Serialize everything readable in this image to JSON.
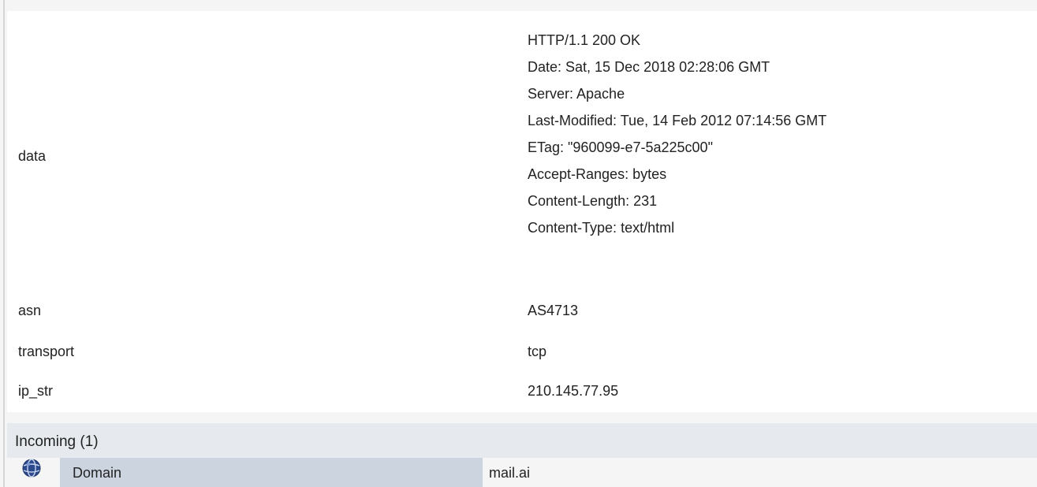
{
  "properties": {
    "data": {
      "key": "data",
      "lines": [
        "HTTP/1.1 200 OK",
        "Date: Sat, 15 Dec 2018 02:28:06 GMT",
        "Server: Apache",
        "Last-Modified: Tue, 14 Feb 2012 07:14:56 GMT",
        "ETag: \"960099-e7-5a225c00\"",
        "Accept-Ranges: bytes",
        "Content-Length: 231",
        "Content-Type: text/html"
      ]
    },
    "asn": {
      "key": "asn",
      "value": "AS4713"
    },
    "transport": {
      "key": "transport",
      "value": "tcp"
    },
    "ip_str": {
      "key": "ip_str",
      "value": "210.145.77.95"
    }
  },
  "incoming": {
    "title": "Incoming (1)",
    "rows": [
      {
        "icon": "globe-icon",
        "type": "Domain",
        "value": "mail.ai"
      }
    ]
  },
  "colors": {
    "panel": "#ffffff",
    "background": "#f5f5f5",
    "section_header": "#e6eaee",
    "type_cell": "#ccd4e0",
    "icon": "#2c4a8c"
  }
}
